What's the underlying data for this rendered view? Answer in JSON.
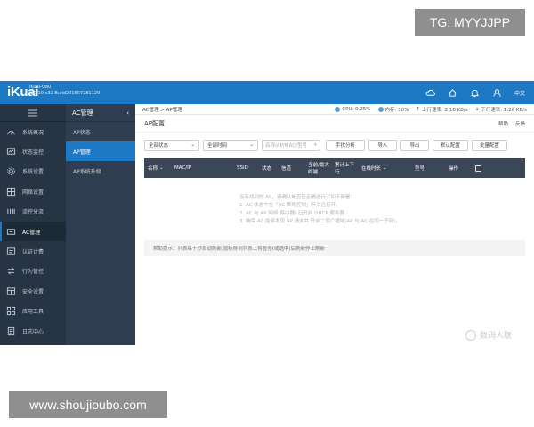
{
  "watermarks": {
    "top": "TG: MYYJJPP",
    "bottom": "www.shoujioubo.com",
    "brand": "数码人联"
  },
  "topbar": {
    "logo": "iKuai",
    "device": "iKuai-Q80",
    "build": "3.0.10 x32 Build201607281129",
    "language": "中文"
  },
  "sidebar": {
    "items": [
      {
        "label": "系统概况",
        "icon": "dashboard-icon"
      },
      {
        "label": "状态监控",
        "icon": "monitor-icon"
      },
      {
        "label": "系统设置",
        "icon": "gear-icon"
      },
      {
        "label": "网络设置",
        "icon": "network-icon"
      },
      {
        "label": "流控分流",
        "icon": "flow-icon"
      },
      {
        "label": "AC管理",
        "icon": "ap-icon"
      },
      {
        "label": "认证计费",
        "icon": "auth-icon"
      },
      {
        "label": "行为管控",
        "icon": "behavior-icon"
      },
      {
        "label": "安全设置",
        "icon": "security-icon"
      },
      {
        "label": "应用工具",
        "icon": "apps-icon"
      },
      {
        "label": "日志中心",
        "icon": "log-icon"
      }
    ],
    "active_index": 5
  },
  "subnav": {
    "title": "AC管理",
    "items": [
      "AP状态",
      "AP管理",
      "AP系统升级"
    ],
    "active_index": 1
  },
  "status": {
    "breadcrumb": "AC管理 > AP管理",
    "cpu": "CPU: 0.25%",
    "memory": "内存: 30%",
    "upload": "上行速率: 2.18 KB/s",
    "download": "下行速率: 1.26 KB/s"
  },
  "page": {
    "title": "AP配置",
    "help": "帮助",
    "feedback": "反馈"
  },
  "toolbar": {
    "status_filter": "全部状态",
    "time_filter": "全部时间",
    "search_placeholder": "名称/AP/MAC/型号",
    "manual_analyze": "手扰分析",
    "import": "导入",
    "export": "导出",
    "default_config": "默认配置",
    "batch_config": "批量配置"
  },
  "table": {
    "headers": [
      "名称",
      "MAC/IP",
      "SSID",
      "状态",
      "信道",
      "当前/最大终端",
      "累计上下行",
      "在线时长",
      "型号",
      "操作"
    ]
  },
  "empty_state": {
    "lines": [
      "没有找到的 AP，请确认是否已正确进行了如下部署：",
      "1. AC 状态中在「AC 策略控制」开关已打开。",
      "2. AC 与 AP 网络(路由器) 已开启 DHCP 服务器。",
      "3. 确保 AC 能够发现 AP 请求并 开启二层广播域(AP 与 AC 在同一子网)。"
    ]
  },
  "tip": "帮助提示：列表每十秒自动刷新,鼠标移到列表上将暂停(或选中)后刷新停止刷新"
}
